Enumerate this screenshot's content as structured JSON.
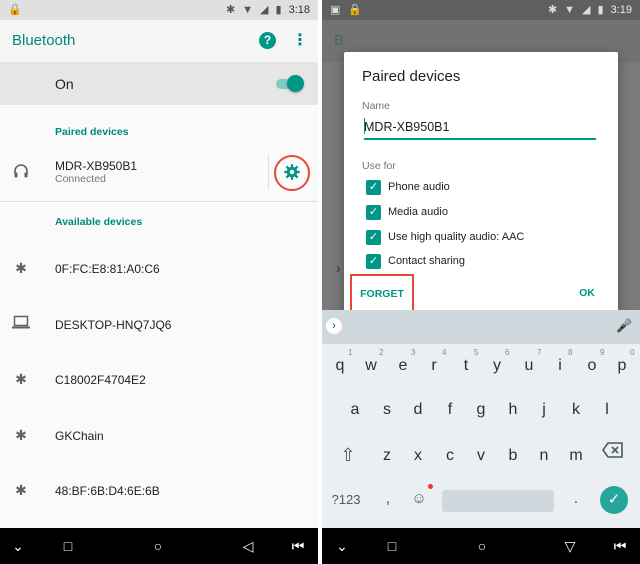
{
  "left": {
    "statusbar": {
      "time": "3:18"
    },
    "appbar": {
      "title": "Bluetooth",
      "help_glyph": "?",
      "more_glyph": "⋮"
    },
    "toggle": {
      "label": "On",
      "state": "on"
    },
    "paired_header": "Paired devices",
    "paired": [
      {
        "name": "MDR-XB950B1",
        "status": "Connected",
        "icon": "headphones-icon"
      }
    ],
    "available_header": "Available devices",
    "available": [
      {
        "name": "0F:FC:E8:81:A0:C6",
        "icon": "bluetooth-icon"
      },
      {
        "name": "DESKTOP-HNQ7JQ6",
        "icon": "laptop-icon"
      },
      {
        "name": "C18002F4704E2",
        "icon": "bluetooth-icon"
      },
      {
        "name": "GKChain",
        "icon": "bluetooth-icon"
      },
      {
        "name": "48:BF:6B:D4:6E:6B",
        "icon": "bluetooth-icon"
      }
    ]
  },
  "right": {
    "statusbar": {
      "time": "3:19"
    },
    "background_title_fragment": "B",
    "dialog": {
      "title": "Paired devices",
      "name_label": "Name",
      "name_value": "MDR-XB950B1",
      "use_for_label": "Use for",
      "options": [
        {
          "label": "Phone audio",
          "checked": true
        },
        {
          "label": "Media audio",
          "checked": true
        },
        {
          "label": "Use high quality audio: AAC",
          "checked": true
        },
        {
          "label": "Contact sharing",
          "checked": true
        }
      ],
      "forget_label": "FORGET",
      "ok_label": "OK"
    },
    "keyboard": {
      "row1": [
        "q",
        "w",
        "e",
        "r",
        "t",
        "y",
        "u",
        "i",
        "o",
        "p"
      ],
      "row1_hints": [
        "1",
        "2",
        "3",
        "4",
        "5",
        "6",
        "7",
        "8",
        "9",
        "0"
      ],
      "row2": [
        "a",
        "s",
        "d",
        "f",
        "g",
        "h",
        "j",
        "k",
        "l"
      ],
      "row3": [
        "z",
        "x",
        "c",
        "v",
        "b",
        "n",
        "m"
      ],
      "symbols_label": "?123",
      "comma": ",",
      "period": "."
    }
  },
  "colors": {
    "accent": "#009688",
    "highlight": "#e8483a"
  }
}
